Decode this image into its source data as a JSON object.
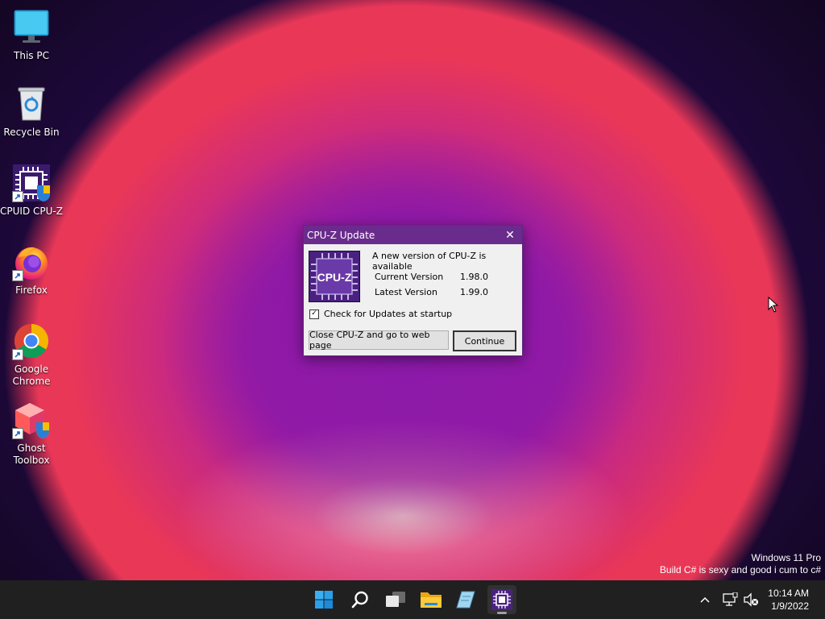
{
  "desktop": {
    "icons": [
      {
        "label": "This PC",
        "icon": "monitor-icon"
      },
      {
        "label": "Recycle Bin",
        "icon": "recycle-bin-icon"
      },
      {
        "label": "CPUID CPU-Z",
        "icon": "cpuz-icon"
      },
      {
        "label": "Firefox",
        "icon": "firefox-icon"
      },
      {
        "label_line1": "Google",
        "label_line2": "Chrome",
        "icon": "chrome-icon"
      },
      {
        "label_line1": "Ghost",
        "label_line2": "Toolbox",
        "icon": "ghost-toolbox-icon"
      }
    ],
    "watermark": {
      "line1": "Windows 11 Pro",
      "line2": "Build C# is sexy and good i cum to c#"
    }
  },
  "dialog": {
    "title": "CPU-Z Update",
    "close_glyph": "✕",
    "logo_text": "CPU-Z",
    "message": "A new version of CPU-Z is available",
    "current_label": "Current Version",
    "current_value": "1.98.0",
    "latest_label": "Latest Version",
    "latest_value": "1.99.0",
    "checkbox_label": "Check for Updates at startup",
    "checkbox_checked": true,
    "btn_close_web": "Close CPU-Z and go to web page",
    "btn_continue": "Continue"
  },
  "taskbar": {
    "apps": [
      "start-icon",
      "search-icon",
      "task-view-icon",
      "file-explorer-icon",
      "notepad-icon",
      "cpuz-icon"
    ],
    "tray": {
      "chevron": "^"
    },
    "clock": {
      "time": "10:14 AM",
      "date": "1/9/2022"
    }
  },
  "colors": {
    "taskbar": "#202020",
    "dialog_title": "#6a2c8c",
    "accent": "#0078d4"
  }
}
